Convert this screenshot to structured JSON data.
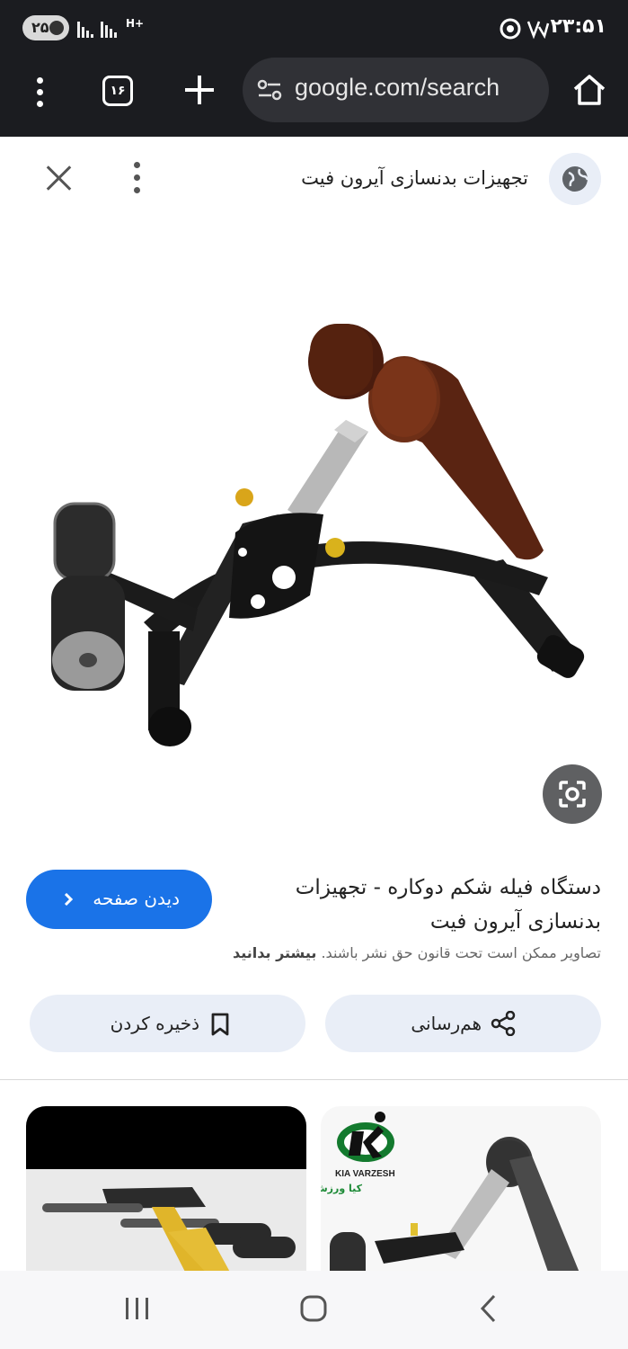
{
  "status_bar": {
    "notification_count": "۲۵",
    "network": "H+",
    "time": "۲۳:۵۱"
  },
  "browser": {
    "tab_count": "۱۶",
    "url": "google.com/search",
    "icons": [
      "more-vert-icon",
      "tabs-icon",
      "new-tab-plus-icon",
      "site-settings-icon",
      "home-icon"
    ]
  },
  "viewer": {
    "site_name": "تجهیزات بدنسازی آیرون فیت",
    "title": "دستگاه فیله شکم دوکاره - تجهیزات بدنسازی آیرون فیت",
    "visit_label": "دیدن صفحه",
    "copyright": "تصاویر ممکن است تحت قانون حق نشر باشند.",
    "learn_more": "بیشتر بدانید",
    "share_label": "هم‌رسانی",
    "save_label": "ذخیره کردن"
  },
  "related": {
    "right_logo_en": "KIA VARZESH",
    "right_logo_fa": "کیا ورزش"
  },
  "colors": {
    "accent": "#1a73e8",
    "dark_bar": "#1b1c20",
    "chip_bg": "#e9eef7"
  }
}
